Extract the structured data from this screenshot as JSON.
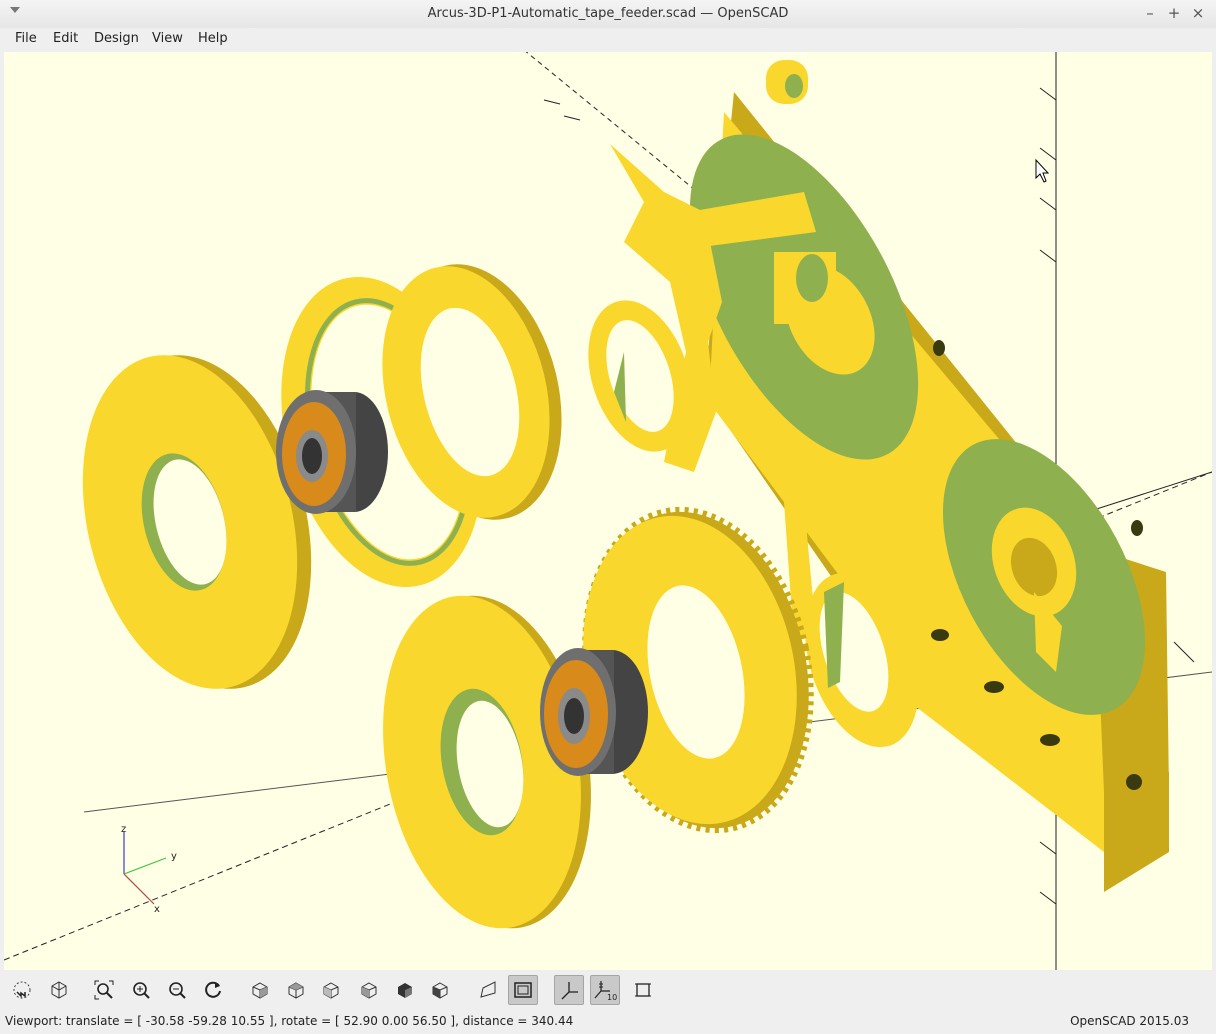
{
  "window": {
    "title": "Arcus-3D-P1-Automatic_tape_feeder.scad — OpenSCAD",
    "minimize_glyph": "–",
    "maximize_glyph": "+",
    "close_glyph": "×"
  },
  "menubar": {
    "items": [
      "File",
      "Edit",
      "Design",
      "View",
      "Help"
    ]
  },
  "viewport": {
    "background": "#ffffe5",
    "model_colors": {
      "face": "#f9d72c",
      "shade": "#c9a81a",
      "cut": "#8fb04e",
      "bearing_steel": "#7a7a7a",
      "bearing_seal": "#d88a1a"
    },
    "axis_labels": {
      "x": "x",
      "y": "y",
      "z": "z"
    }
  },
  "toolbar": {
    "buttons": [
      {
        "name": "preview-icon",
        "tooltip": "Preview"
      },
      {
        "name": "render-icon",
        "tooltip": "Render"
      },
      {
        "name": "view-all-icon",
        "tooltip": "View All"
      },
      {
        "name": "zoom-in-icon",
        "tooltip": "Zoom In"
      },
      {
        "name": "zoom-out-icon",
        "tooltip": "Zoom Out"
      },
      {
        "name": "reset-view-icon",
        "tooltip": "Reset View"
      },
      {
        "name": "view-right-icon",
        "tooltip": "Right"
      },
      {
        "name": "view-top-icon",
        "tooltip": "Top"
      },
      {
        "name": "view-bottom-icon",
        "tooltip": "Bottom"
      },
      {
        "name": "view-left-icon",
        "tooltip": "Left"
      },
      {
        "name": "view-front-icon",
        "tooltip": "Front"
      },
      {
        "name": "view-back-icon",
        "tooltip": "Back"
      },
      {
        "name": "perspective-icon",
        "tooltip": "Perspective"
      },
      {
        "name": "orthogonal-icon",
        "tooltip": "Orthogonal"
      },
      {
        "name": "show-axes-icon",
        "tooltip": "Show Axes"
      },
      {
        "name": "show-scale-markers-icon",
        "tooltip": "Show Scale Markers"
      },
      {
        "name": "show-edges-icon",
        "tooltip": "Show Edges"
      }
    ],
    "scale_marker_label": "10"
  },
  "status": {
    "viewport_text": "Viewport: translate = [ -30.58 -59.28 10.55 ], rotate = [ 52.90 0.00 56.50 ], distance = 340.44",
    "version": "OpenSCAD 2015.03"
  }
}
